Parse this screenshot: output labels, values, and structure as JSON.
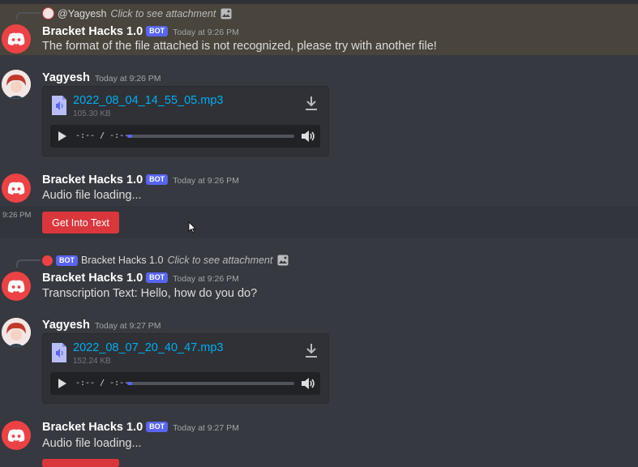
{
  "colors": {
    "bg": "#36393f",
    "highlight": "#49443c",
    "brand": "#5865f2",
    "danger": "#da373c",
    "link": "#00aff4"
  },
  "messages": [
    {
      "reply": {
        "name": "@Yagyesh",
        "text": "Click to see attachment",
        "icon": "image-icon"
      },
      "author": "Bracket Hacks 1.0",
      "badge": "BOT",
      "time": "Today at 9:26 PM",
      "text": "The format of the file attached is not recognized, please try with another file!"
    },
    {
      "author": "Yagyesh",
      "time": "Today at 9:26 PM",
      "attachment": {
        "filename": "2022_08_04_14_55_05.mp3",
        "size": "105.30 KB",
        "time": "-:-- / -:--",
        "progress": 0.03
      }
    },
    {
      "author": "Bracket Hacks 1.0",
      "badge": "BOT",
      "time": "Today at 9:26 PM",
      "text": "Audio file loading...",
      "side_time": "9:26 PM",
      "button": "Get Into Text"
    },
    {
      "reply": {
        "badge": "BOT",
        "name": "Bracket Hacks 1.0",
        "text": "Click to see attachment",
        "icon": "image-icon"
      },
      "author": "Bracket Hacks 1.0",
      "badge": "BOT",
      "time": "Today at 9:26 PM",
      "text": "Transcription Text: Hello, how do you do?"
    },
    {
      "author": "Yagyesh",
      "time": "Today at 9:27 PM",
      "attachment": {
        "filename": "2022_08_07_20_40_47.mp3",
        "size": "152.24 KB",
        "time": "-:-- / -:--",
        "progress": 0.03
      }
    },
    {
      "author": "Bracket Hacks 1.0",
      "badge": "BOT",
      "time": "Today at 9:27 PM",
      "text": "Audio file loading..."
    }
  ]
}
